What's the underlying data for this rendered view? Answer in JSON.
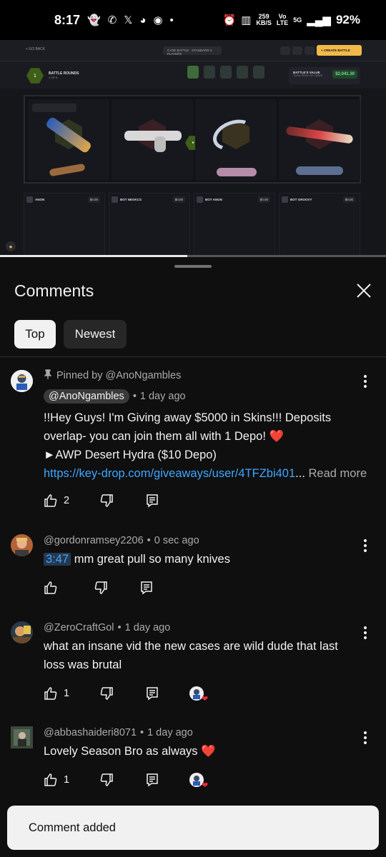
{
  "status_bar": {
    "time": "8:17",
    "notification_icons": [
      "snapchat-icon",
      "whatsapp-icon",
      "x-icon",
      "reddit-icon",
      "app-icon"
    ],
    "dot": "•",
    "net_speed_value": "259",
    "net_speed_unit": "KB/S",
    "volte_top": "Vo",
    "volte_bottom": "LTE",
    "network": "5G",
    "battery": "92%"
  },
  "video": {
    "back": "< GO BACK",
    "battle_title": "CASE BATTLE · STANDARD 4 PLAYERS",
    "create_button": "+ CREATE BATTLE",
    "round_number": "1",
    "rounds_label": "BATTLE ROUNDS",
    "rounds_sub": "1 OF 5",
    "value_label": "BATTLE'S VALUE",
    "value_sub": "TOTAL PRICE OF CASES",
    "value": "$2,041.30",
    "players": [
      {
        "name": "ANON",
        "amount": "$0.00"
      },
      {
        "name": "BOT NEOKCS",
        "amount": "$0.00"
      },
      {
        "name": "BOT ANON",
        "amount": "$0.00"
      },
      {
        "name": "BOT GROOVY",
        "amount": "$0.00"
      }
    ],
    "progress": 0.485
  },
  "sheet": {
    "title": "Comments",
    "close_icon": "close-icon",
    "filters": [
      "Top",
      "Newest"
    ],
    "selected_filter": "Top"
  },
  "comments": [
    {
      "pinned_label": "Pinned by @AnoNgambles",
      "author": "@AnoNgambles",
      "time": "1 day ago",
      "line1": "!!Hey Guys! I'm Giving away $5000 in Skins!!! Deposits overlap- you can join them all with 1 Depo! ❤️",
      "line2": "►AWP Desert Hydra ($10 Depo)",
      "link": "https://key-drop.com/giveaways/user/4TFZbi401",
      "ellipsis": "...",
      "read_more": "Read more",
      "likes": "2"
    },
    {
      "author": "@gordonramsey2206",
      "time": "0 sec ago",
      "timestamp": "3:47",
      "text": "mm great pull so many knives",
      "likes": ""
    },
    {
      "author": "@ZeroCraftGol",
      "time": "1 day ago",
      "text": "what an insane vid the new cases are wild dude that last loss was brutal",
      "likes": "1"
    },
    {
      "author": "@abbashaideri8071",
      "time": "1 day ago",
      "text": "Lovely Season Bro as always ❤️",
      "likes": "1"
    }
  ],
  "separator": "•",
  "snackbar": "Comment added",
  "colors": {
    "background": "#0f0f0f",
    "link": "#3ea6ff",
    "secondary_text": "#aaaaaa",
    "chip_active": "#f1f1f1",
    "heart": "#ff2b43"
  }
}
